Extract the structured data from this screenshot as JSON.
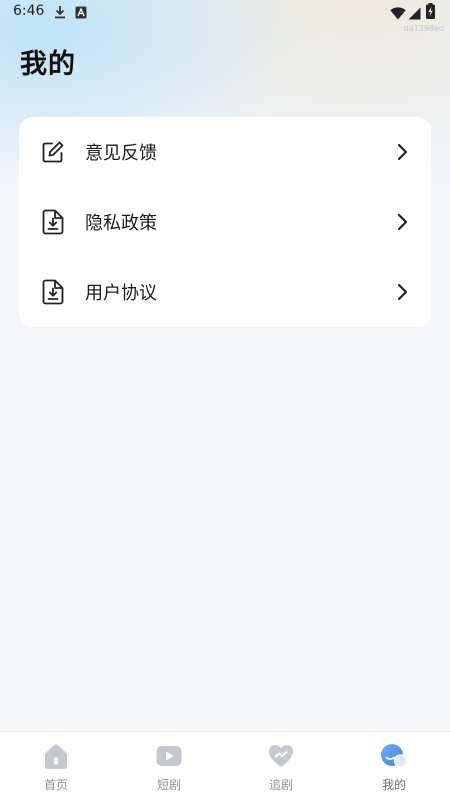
{
  "status_bar": {
    "time": "6:46",
    "watermark": "da1398ed"
  },
  "header": {
    "title": "我的"
  },
  "menu": {
    "items": [
      {
        "label": "意见反馈",
        "icon": "edit-icon"
      },
      {
        "label": "隐私政策",
        "icon": "document-icon"
      },
      {
        "label": "用户协议",
        "icon": "document-icon"
      }
    ]
  },
  "tab_bar": {
    "tabs": [
      {
        "label": "首页",
        "icon": "home-icon",
        "active": false
      },
      {
        "label": "短剧",
        "icon": "play-icon",
        "active": false
      },
      {
        "label": "追剧",
        "icon": "heart-icon",
        "active": false
      },
      {
        "label": "我的",
        "icon": "profile-icon",
        "active": true
      }
    ]
  },
  "colors": {
    "accent": "#4a90e8",
    "tab_inactive": "#c5c9cf",
    "background": "#f4f6fa"
  }
}
